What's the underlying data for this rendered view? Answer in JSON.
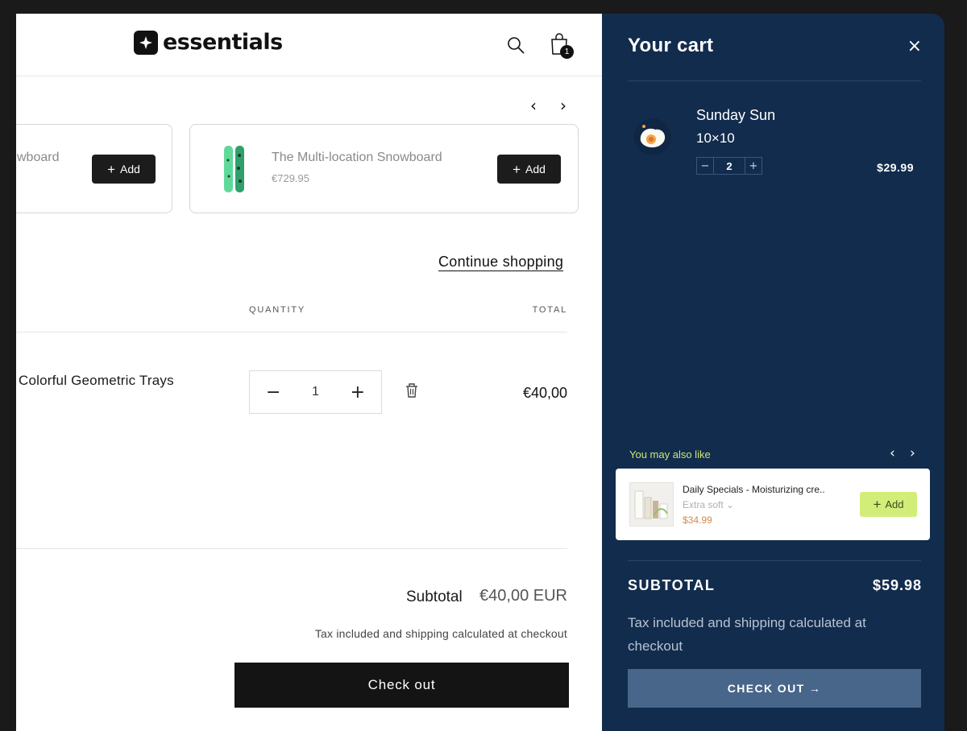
{
  "store": {
    "logo_text": "essentials",
    "cart_count": "1",
    "carousel": {
      "cards": [
        {
          "title": "wboard",
          "add_label": "Add"
        },
        {
          "title": "The Multi-location Snowboard",
          "price": "€729.95",
          "add_label": "Add"
        }
      ]
    },
    "continue_label": "Continue shopping",
    "columns": {
      "quantity": "QUANTITY",
      "total": "TOTAL"
    },
    "line_item": {
      "name": "Colorful Geometric Trays",
      "quantity": "1",
      "total": "€40,00"
    },
    "subtotal_label": "Subtotal",
    "subtotal_value": "€40,00 EUR",
    "tax_note": "Tax included and shipping calculated at checkout",
    "checkout_label": "Check out"
  },
  "drawer": {
    "title": "Your cart",
    "close_glyph": "×",
    "item": {
      "name": "Sunday Sun",
      "variant": "10×10",
      "quantity": "2",
      "price": "$29.99"
    },
    "upsell": {
      "heading": "You may also like",
      "name": "Daily Specials - Moisturizing cre..",
      "variant": "Extra soft",
      "price": "$34.99",
      "add_label": "Add"
    },
    "subtotal_label": "SUBTOTAL",
    "subtotal_value": "$59.98",
    "tax_note": "Tax included and shipping calculated at checkout",
    "checkout_label": "CHECK OUT →"
  },
  "colors": {
    "drawer_bg": "#122c4d",
    "drawer_checkout": "#476689",
    "accent_green": "#d2ee79",
    "upsell_price": "#d6884a"
  },
  "icons": [
    "logo-mark-icon",
    "search-icon",
    "cart-bag-icon",
    "chevron-left-icon",
    "chevron-right-icon",
    "plus-icon",
    "minus-icon",
    "trash-icon",
    "close-icon",
    "chevron-down-icon",
    "arrow-right-icon"
  ]
}
